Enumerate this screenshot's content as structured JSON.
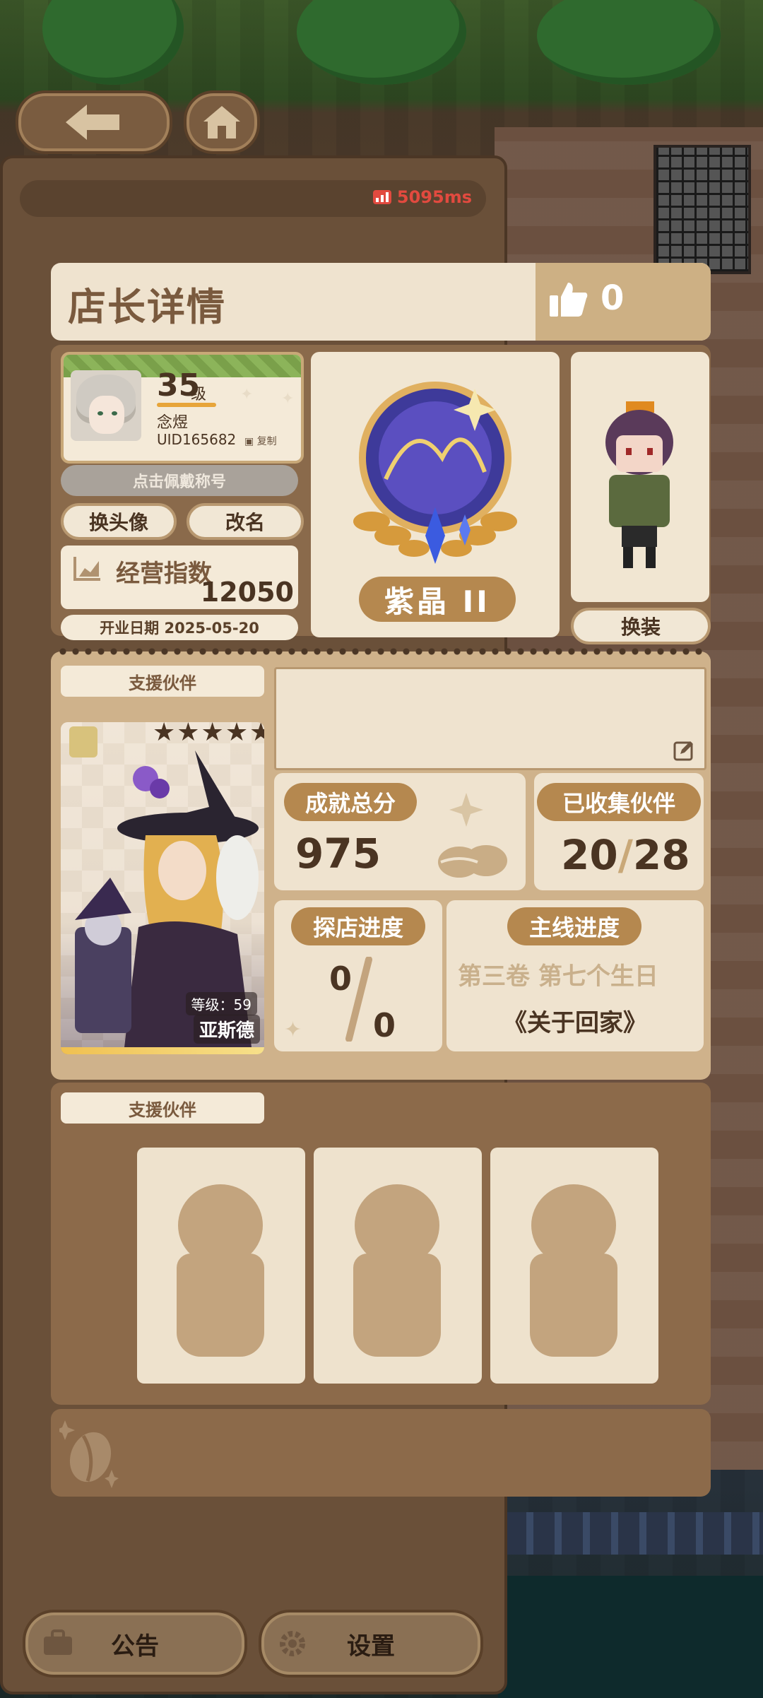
{
  "network": {
    "ping": "5095ms"
  },
  "modal": {
    "title": "店长详情",
    "likes": "0"
  },
  "profile": {
    "level": "35",
    "level_unit": "级",
    "name": "念煜",
    "uid": "UID165682",
    "copy_label": "复制",
    "title_prompt": "点击佩戴称号",
    "change_avatar_label": "换头像",
    "rename_label": "改名",
    "business_index_label": "经营指数",
    "business_index_value": "12050",
    "open_date": "开业日期 2025-05-20"
  },
  "rank": {
    "name": "紫晶 II"
  },
  "outfit": {
    "button_label": "换装"
  },
  "support": {
    "section_label": "支援伙伴",
    "partner": {
      "stars": "★★★★★",
      "level_text": "等级：59",
      "name": "亚斯德"
    }
  },
  "stats": {
    "achievement_label": "成就总分",
    "achievement_value": "975",
    "collected_label": "已收集伙伴",
    "collected_value": "20",
    "collected_total": "28",
    "explore_label": "探店进度",
    "explore_value": "0",
    "explore_total": "0",
    "main_story_label": "主线进度",
    "main_story_chapter": "第三卷 第七个生日",
    "main_story_title": "《关于回家》"
  },
  "support2": {
    "section_label": "支援伙伴"
  },
  "bottom_nav": {
    "notice_label": "公告",
    "settings_label": "设置"
  },
  "colors": {
    "accent_gold": "#b5884f",
    "panel_brown": "#8c6a4a",
    "card_cream": "#efe3cf",
    "ping_red": "#e24a3f"
  }
}
